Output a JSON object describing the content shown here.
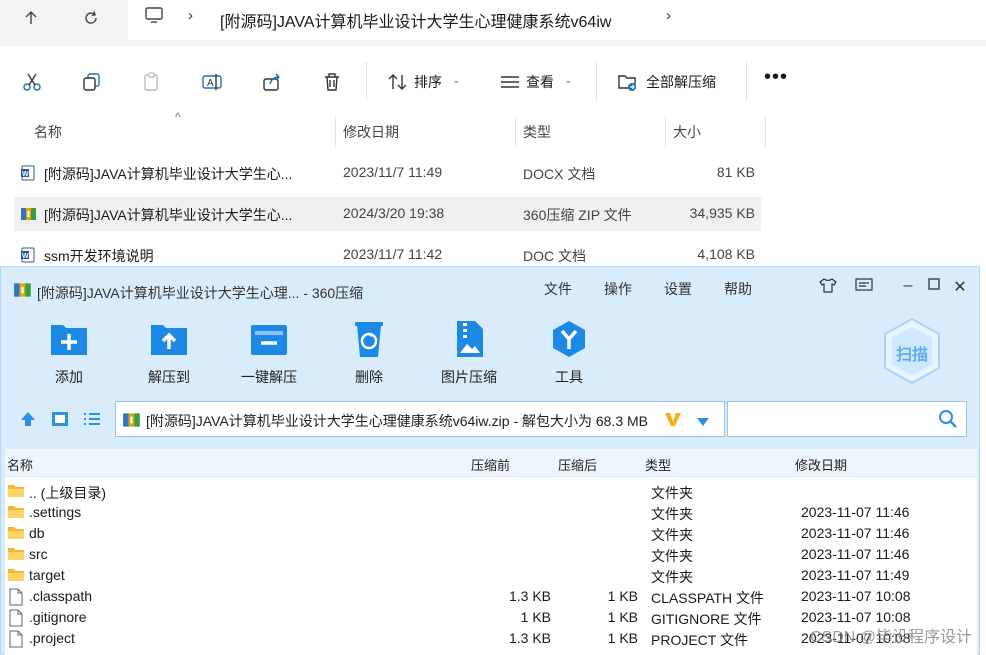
{
  "explorer": {
    "breadcrumb": "[附源码]JAVA计算机毕业设计大学生心理健康系统v64iw",
    "commands": {
      "sort": "排序",
      "view": "查看",
      "extract_all": "全部解压缩"
    },
    "columns": {
      "name": "名称",
      "modified": "修改日期",
      "type": "类型",
      "size": "大小"
    },
    "files": [
      {
        "name": "[附源码]JAVA计算机毕业设计大学生心...",
        "modified": "2023/11/7 11:49",
        "type": "DOCX 文档",
        "size": "81 KB",
        "icon": "word-icon"
      },
      {
        "name": "[附源码]JAVA计算机毕业设计大学生心...",
        "modified": "2024/3/20 19:38",
        "type": "360压缩 ZIP 文件",
        "size": "34,935 KB",
        "icon": "zip-icon"
      },
      {
        "name": "ssm开发环境说明",
        "modified": "2023/11/7 11:42",
        "type": "DOC 文档",
        "size": "4,108 KB",
        "icon": "word-icon"
      }
    ]
  },
  "zip_window": {
    "title": "[附源码]JAVA计算机毕业设计大学生心理... - 360压缩",
    "menu": {
      "file": "文件",
      "operate": "操作",
      "settings": "设置",
      "help": "帮助"
    },
    "tools": {
      "add": "添加",
      "extract_to": "解压到",
      "one_click_extract": "一键解压",
      "delete": "删除",
      "image_compress": "图片压缩",
      "tools": "工具"
    },
    "scan_label": "扫描",
    "path": "[附源码]JAVA计算机毕业设计大学生心理健康系统v64iw.zip - 解包大小为 68.3 MB",
    "columns": {
      "name": "名称",
      "before": "压缩前",
      "after": "压缩后",
      "type": "类型",
      "modified": "修改日期"
    },
    "entries": [
      {
        "name": ".. (上级目录)",
        "before": "",
        "after": "",
        "type": "文件夹",
        "modified": "",
        "icon": "folder-icon"
      },
      {
        "name": ".settings",
        "before": "",
        "after": "",
        "type": "文件夹",
        "modified": "2023-11-07 11:46",
        "icon": "folder-icon"
      },
      {
        "name": "db",
        "before": "",
        "after": "",
        "type": "文件夹",
        "modified": "2023-11-07 11:46",
        "icon": "folder-icon"
      },
      {
        "name": "src",
        "before": "",
        "after": "",
        "type": "文件夹",
        "modified": "2023-11-07 11:46",
        "icon": "folder-icon"
      },
      {
        "name": "target",
        "before": "",
        "after": "",
        "type": "文件夹",
        "modified": "2023-11-07 11:49",
        "icon": "folder-icon"
      },
      {
        "name": ".classpath",
        "before": "1.3 KB",
        "after": "1 KB",
        "type": "CLASSPATH 文件",
        "modified": "2023-11-07 10:08",
        "icon": "file-icon"
      },
      {
        "name": ".gitignore",
        "before": "1 KB",
        "after": "1 KB",
        "type": "GITIGNORE 文件",
        "modified": "2023-11-07 10:08",
        "icon": "file-icon"
      },
      {
        "name": ".project",
        "before": "1.3 KB",
        "after": "1 KB",
        "type": "PROJECT 文件",
        "modified": "2023-11-07 10:08",
        "icon": "file-icon"
      }
    ]
  },
  "watermark": "CSDN @毕设程序设计",
  "colors": {
    "zip_window_bg": "#d9ecfb",
    "tool_blue": "#1e88e5",
    "selected_row": "#f0f0f0",
    "folder": "#f5b731"
  }
}
